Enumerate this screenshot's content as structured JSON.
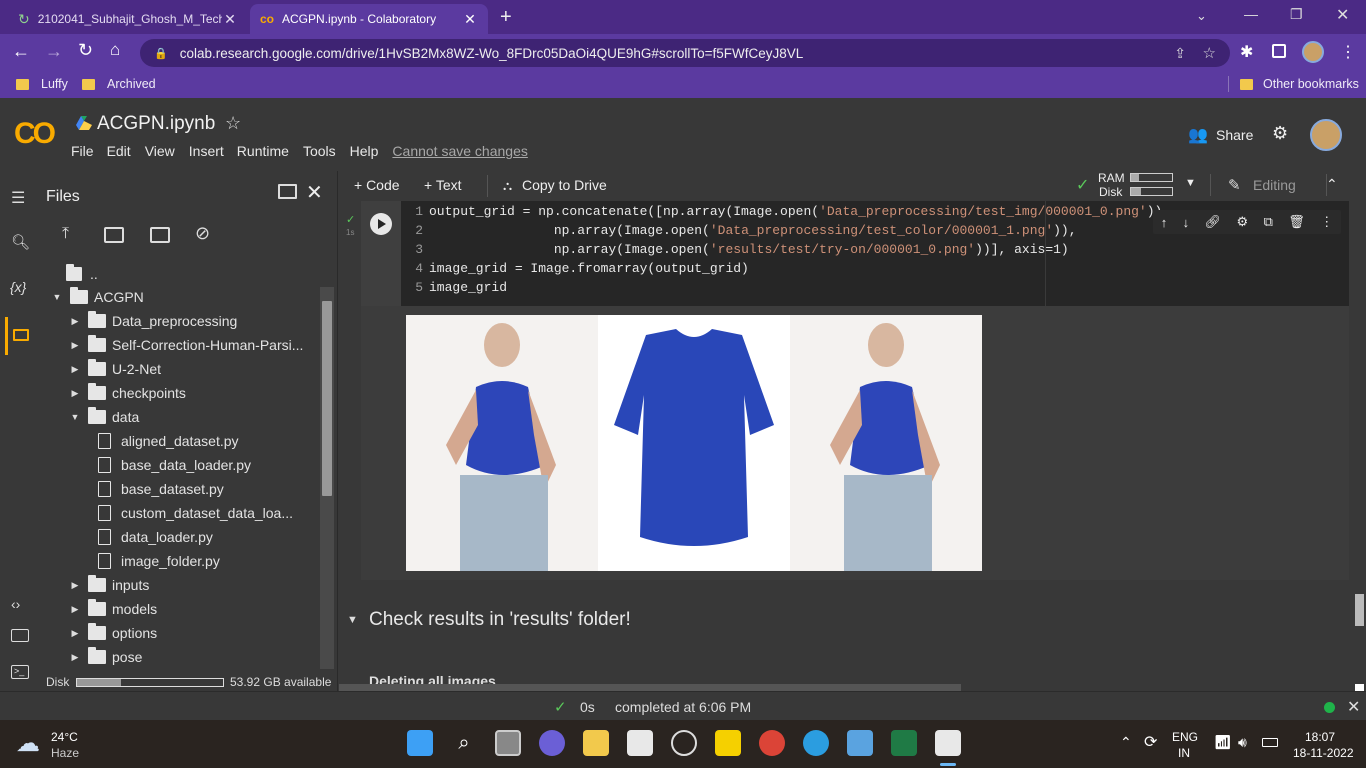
{
  "browser": {
    "tabs": [
      {
        "title": "2102041_Subhajit_Ghosh_M_Tech",
        "icon": "gradio-icon",
        "active": false
      },
      {
        "title": "ACGPN.ipynb - Colaboratory",
        "icon": "colab-icon",
        "active": true
      }
    ],
    "url": "colab.research.google.com/drive/1HvSB2Mx8WZ-Wo_8FDrc05DaOi4QUE9hG#scrollTo=f5FWfCeyJ8VL",
    "bookmarks": [
      "Luffy",
      "Archived"
    ],
    "other_bookmarks": "Other bookmarks"
  },
  "colab": {
    "logo": "CO",
    "notebook_name": "ACGPN.ipynb",
    "menu": [
      "File",
      "Edit",
      "View",
      "Insert",
      "Runtime",
      "Tools",
      "Help"
    ],
    "save_status": "Cannot save changes",
    "share_label": "Share"
  },
  "toolbar": {
    "code_label": "+ Code",
    "text_label": "+ Text",
    "copy_label": "Copy to Drive",
    "ram_label": "RAM",
    "disk_label": "Disk",
    "editing_label": "Editing"
  },
  "sidebar": {
    "title": "Files",
    "parent": "..",
    "tree": [
      {
        "name": "ACGPN",
        "type": "folder",
        "depth": 0,
        "expanded": true
      },
      {
        "name": "Data_preprocessing",
        "type": "folder",
        "depth": 1,
        "expanded": false
      },
      {
        "name": "Self-Correction-Human-Parsi...",
        "type": "folder",
        "depth": 1,
        "expanded": false
      },
      {
        "name": "U-2-Net",
        "type": "folder",
        "depth": 1,
        "expanded": false
      },
      {
        "name": "checkpoints",
        "type": "folder",
        "depth": 1,
        "expanded": false
      },
      {
        "name": "data",
        "type": "folder",
        "depth": 1,
        "expanded": true
      },
      {
        "name": "aligned_dataset.py",
        "type": "file",
        "depth": 2
      },
      {
        "name": "base_data_loader.py",
        "type": "file",
        "depth": 2
      },
      {
        "name": "base_dataset.py",
        "type": "file",
        "depth": 2
      },
      {
        "name": "custom_dataset_data_loa...",
        "type": "file",
        "depth": 2
      },
      {
        "name": "data_loader.py",
        "type": "file",
        "depth": 2
      },
      {
        "name": "image_folder.py",
        "type": "file",
        "depth": 2
      },
      {
        "name": "inputs",
        "type": "folder",
        "depth": 1,
        "expanded": false
      },
      {
        "name": "models",
        "type": "folder",
        "depth": 1,
        "expanded": false
      },
      {
        "name": "options",
        "type": "folder",
        "depth": 1,
        "expanded": false
      },
      {
        "name": "pose",
        "type": "folder",
        "depth": 1,
        "expanded": false
      }
    ],
    "disk_label": "Disk",
    "disk_available": "53.92 GB available",
    "disk_used_fraction": 0.3
  },
  "cell": {
    "exec_time": "1s",
    "lines": [
      [
        "1",
        "output_grid = np.concatenate([np.array(Image.open('Data_preprocessing/test_img/000001_0.png')),"
      ],
      [
        "2",
        "                np.array(Image.open('Data_preprocessing/test_color/000001_1.png')),"
      ],
      [
        "3",
        "                np.array(Image.open('results/test/try-on/000001_0.png'))], axis=1)"
      ],
      [
        "4",
        "image_grid = Image.fromarray(output_grid)"
      ],
      [
        "5",
        "image_grid"
      ]
    ]
  },
  "section_heading": "Check results in 'results' folder!",
  "next_heading": "Deleting all images",
  "status": {
    "time": "0s",
    "message": "completed at 6:06 PM"
  },
  "taskbar": {
    "weather_temp": "24°C",
    "weather_desc": "Haze",
    "lang1": "ENG",
    "lang2": "IN",
    "time": "18:07",
    "date": "18-11-2022"
  }
}
